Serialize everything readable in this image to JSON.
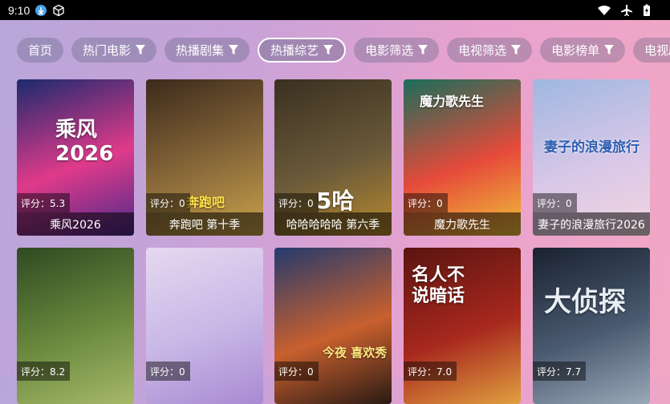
{
  "status_bar": {
    "time": "9:10"
  },
  "tabs": [
    {
      "label": "首页",
      "has_filter": false,
      "active": false
    },
    {
      "label": "热门电影",
      "has_filter": true,
      "active": false
    },
    {
      "label": "热播剧集",
      "has_filter": true,
      "active": false
    },
    {
      "label": "热播综艺",
      "has_filter": true,
      "active": true
    },
    {
      "label": "电影筛选",
      "has_filter": true,
      "active": false
    },
    {
      "label": "电视筛选",
      "has_filter": true,
      "active": false
    },
    {
      "label": "电影榜单",
      "has_filter": true,
      "active": false
    },
    {
      "label": "电视剧",
      "has_filter": false,
      "active": false
    }
  ],
  "cards": [
    {
      "title": "乘风2026",
      "score": "评分：5.3",
      "poster_text": "乘风\n2026",
      "colors": [
        "#1c2a6e",
        "#e03a8a",
        "#4a2a8a"
      ]
    },
    {
      "title": "奔跑吧 第十季",
      "score": "评分：0",
      "poster_text": "奔跑吧",
      "colors": [
        "#3d2a1c",
        "#8a6a3a",
        "#c9a24a"
      ]
    },
    {
      "title": "哈哈哈哈哈 第六季",
      "score": "评分：0",
      "poster_text": "5哈",
      "colors": [
        "#3a3020",
        "#6a5a3a",
        "#b8892e"
      ]
    },
    {
      "title": "魔力歌先生",
      "score": "评分：0",
      "poster_text": "魔力歌先生",
      "colors": [
        "#1b6d5a",
        "#e64a3a",
        "#f0c23a"
      ]
    },
    {
      "title": "妻子的浪漫旅行2026",
      "score": "评分：0",
      "poster_text": "妻子的浪漫旅行",
      "colors": [
        "#9fb7e0",
        "#d8c7e8",
        "#f2d6e0"
      ]
    },
    {
      "title": "",
      "score": "评分：8.2",
      "poster_text": "",
      "colors": [
        "#2f4a22",
        "#6b8a3e",
        "#a6b86a"
      ]
    },
    {
      "title": "",
      "score": "评分：0",
      "poster_text": "",
      "colors": [
        "#e6d8f0",
        "#c8b6e6",
        "#a88ad2"
      ]
    },
    {
      "title": "",
      "score": "评分：0",
      "poster_text": "今夜 喜欢秀",
      "colors": [
        "#243a6e",
        "#c8602e",
        "#2a1a14"
      ]
    },
    {
      "title": "",
      "score": "评分：7.0",
      "poster_text": "名人不说暗话",
      "colors": [
        "#5a1410",
        "#a8281e",
        "#e0a040"
      ]
    },
    {
      "title": "",
      "score": "评分：7.7",
      "poster_text": "大侦探",
      "colors": [
        "#1a2230",
        "#4a5a70",
        "#9aa8b8"
      ]
    }
  ]
}
